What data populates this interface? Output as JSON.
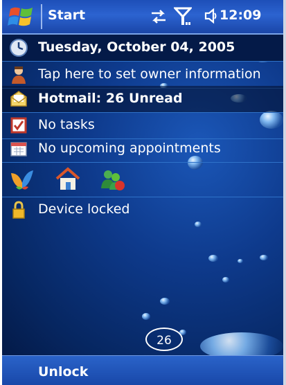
{
  "titlebar": {
    "start_label": "Start",
    "time": "12:09"
  },
  "today": {
    "date": "Tuesday, October 04, 2005",
    "owner": "Tap here to set owner information",
    "mail": "Hotmail: 26 Unread",
    "tasks": "No tasks",
    "appointments": "No upcoming appointments",
    "unread_badge": "26",
    "locked": "Device locked"
  },
  "softkeys": {
    "left": "Unlock"
  },
  "icons": [
    "windows-flag-icon",
    "sync-icon",
    "signal-icon",
    "speaker-icon",
    "clock-icon",
    "owner-icon",
    "mail-icon",
    "tasks-icon",
    "calendar-icon",
    "msn-butterfly-icon",
    "home-icon",
    "contacts-icon",
    "lock-icon"
  ]
}
